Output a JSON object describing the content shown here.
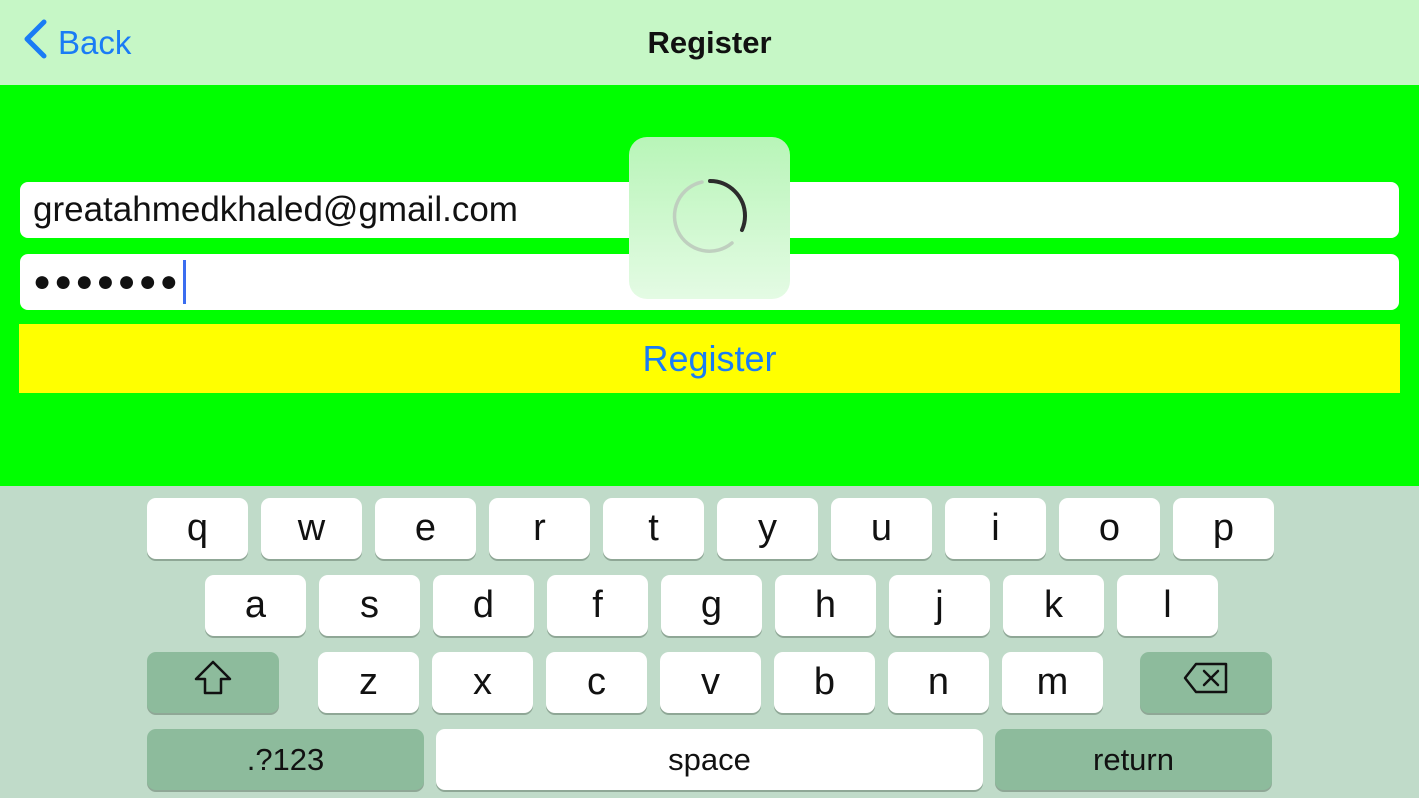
{
  "nav": {
    "back_label": "Back",
    "title": "Register",
    "back_icon": "chevron-left-icon"
  },
  "form": {
    "email_value": "greatahmedkhaled@gmail.com",
    "password_mask": "●●●●●●●",
    "register_label": "Register"
  },
  "hud": {
    "icon": "spinner-icon"
  },
  "keyboard": {
    "row1": [
      "q",
      "w",
      "e",
      "r",
      "t",
      "y",
      "u",
      "i",
      "o",
      "p"
    ],
    "row2": [
      "a",
      "s",
      "d",
      "f",
      "g",
      "h",
      "j",
      "k",
      "l"
    ],
    "row3": [
      "z",
      "x",
      "c",
      "v",
      "b",
      "n",
      "m"
    ],
    "shift_icon": "shift-icon",
    "delete_icon": "delete-icon",
    "numbers_label": ".?123",
    "space_label": "space",
    "return_label": "return"
  },
  "colors": {
    "nav_bg": "#c6f7c6",
    "content_bg": "#00ff00",
    "button_bg": "#ffff00",
    "accent": "#1a7cf5",
    "keyboard_bg": "#c0dbc9",
    "special_key_bg": "#8dbb9c"
  }
}
